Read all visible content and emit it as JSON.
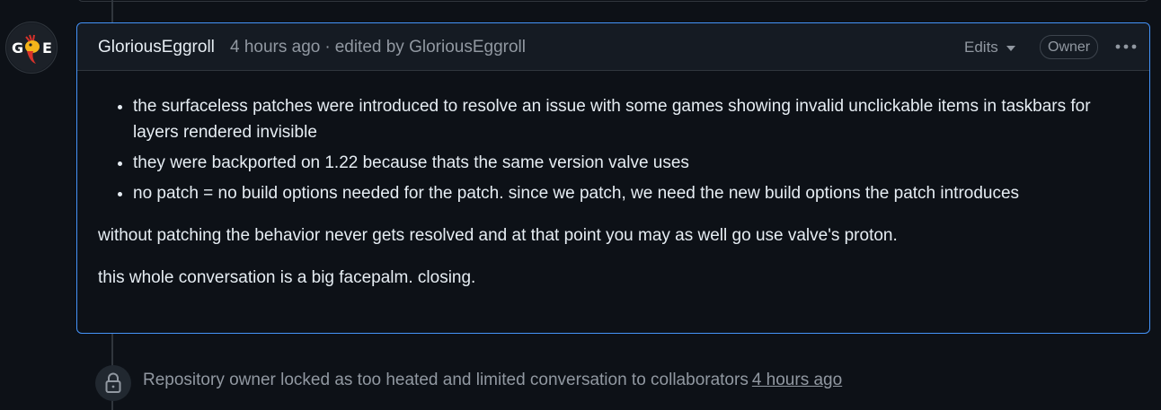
{
  "comment": {
    "author": "GloriousEggroll",
    "time": "4 hours ago",
    "separator": "·",
    "edited_by_label": "edited by GloriousEggroll",
    "edits_label": "Edits",
    "owner_badge": "Owner",
    "bullets": [
      "the surfaceless patches were introduced to resolve an issue with some games showing invalid unclickable items in taskbars for layers rendered invisible",
      "they were backported on 1.22 because thats the same version valve uses",
      "no patch = no build options needed for the patch. since we patch, we need the new build options the patch introduces"
    ],
    "paragraphs": [
      "without patching the behavior never gets resolved and at that point you may as well go use valve's proton.",
      "this whole conversation is a big facepalm. closing."
    ]
  },
  "avatar": {
    "letters": [
      "G",
      "E"
    ]
  },
  "event": {
    "text": "Repository owner locked as too heated and limited conversation to collaborators",
    "time": "4 hours ago",
    "icon": "lock-icon"
  },
  "colors": {
    "background": "#0d1117",
    "header": "#151b23",
    "accent_border": "#4493f8",
    "muted_text": "#9198a1",
    "text": "#e6edf3"
  }
}
